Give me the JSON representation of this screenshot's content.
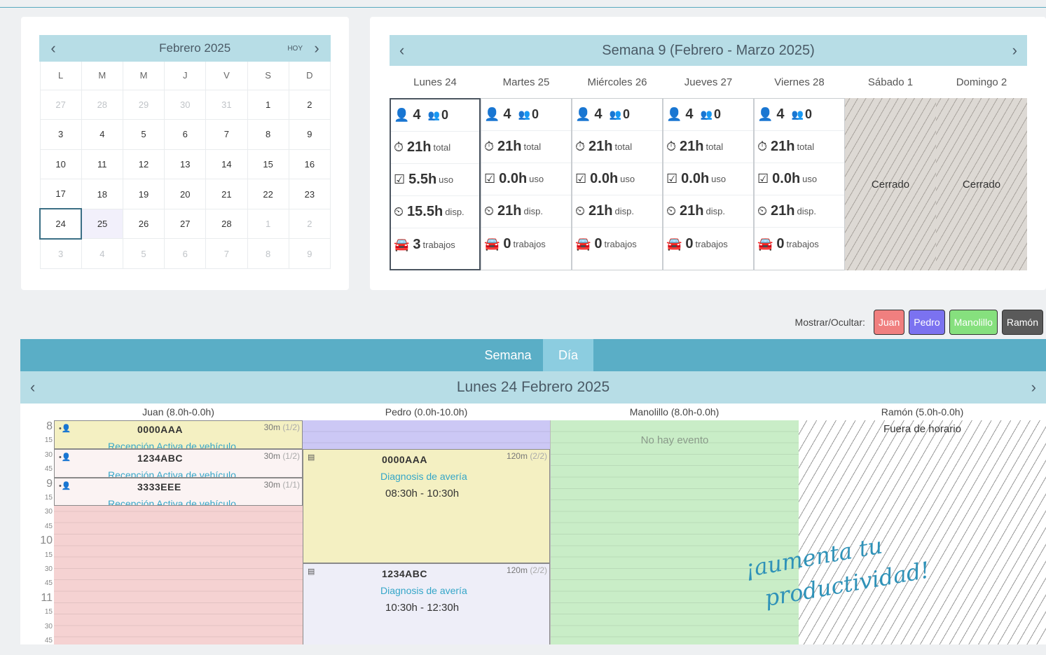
{
  "mini_calendar": {
    "title": "Febrero 2025",
    "today_label": "HOY",
    "prev": "‹",
    "next": "›",
    "weekdays": [
      "L",
      "M",
      "M",
      "J",
      "V",
      "S",
      "D"
    ],
    "weeks": [
      [
        "27",
        "28",
        "29",
        "30",
        "31",
        "1",
        "2"
      ],
      [
        "3",
        "4",
        "5",
        "6",
        "7",
        "8",
        "9"
      ],
      [
        "10",
        "11",
        "12",
        "13",
        "14",
        "15",
        "16"
      ],
      [
        "17",
        "18",
        "19",
        "20",
        "21",
        "22",
        "23"
      ],
      [
        "24",
        "25",
        "26",
        "27",
        "28",
        "1",
        "2"
      ],
      [
        "3",
        "4",
        "5",
        "6",
        "7",
        "8",
        "9"
      ]
    ]
  },
  "week_summary": {
    "title": "Semana 9 (Febrero - Marzo 2025)",
    "prev": "‹",
    "next": "›",
    "days": [
      "Lunes 24",
      "Martes 25",
      "Miércoles 26",
      "Jueves 27",
      "Viernes 28",
      "Sábado 1",
      "Domingo 2"
    ],
    "open_days": [
      {
        "staff": "4",
        "absent": "0",
        "total": "21h",
        "total_label": "total",
        "used": "5.5h",
        "used_label": "uso",
        "avail": "15.5h",
        "avail_label": "disp.",
        "jobs": "3",
        "jobs_label": "trabajos"
      },
      {
        "staff": "4",
        "absent": "0",
        "total": "21h",
        "total_label": "total",
        "used": "0.0h",
        "used_label": "uso",
        "avail": "21h",
        "avail_label": "disp.",
        "jobs": "0",
        "jobs_label": "trabajos"
      },
      {
        "staff": "4",
        "absent": "0",
        "total": "21h",
        "total_label": "total",
        "used": "0.0h",
        "used_label": "uso",
        "avail": "21h",
        "avail_label": "disp.",
        "jobs": "0",
        "jobs_label": "trabajos"
      },
      {
        "staff": "4",
        "absent": "0",
        "total": "21h",
        "total_label": "total",
        "used": "0.0h",
        "used_label": "uso",
        "avail": "21h",
        "avail_label": "disp.",
        "jobs": "0",
        "jobs_label": "trabajos"
      },
      {
        "staff": "4",
        "absent": "0",
        "total": "21h",
        "total_label": "total",
        "used": "0.0h",
        "used_label": "uso",
        "avail": "21h",
        "avail_label": "disp.",
        "jobs": "0",
        "jobs_label": "trabajos"
      }
    ],
    "closed_label": "Cerrado"
  },
  "filter": {
    "label": "Mostrar/Ocultar:",
    "chips": [
      {
        "name": "Juan",
        "color": "#f07f7f"
      },
      {
        "name": "Pedro",
        "color": "#7b72f0"
      },
      {
        "name": "Manolillo",
        "color": "#86e07e"
      },
      {
        "name": "Ramón",
        "color": "#5a5a5a"
      }
    ]
  },
  "tabs": [
    "Semana",
    "Día"
  ],
  "day_view": {
    "title": "Lunes 24 Febrero 2025",
    "prev": "‹",
    "next": "›",
    "columns": [
      "Juan (8.0h-0.0h)",
      "Pedro (0.0h-10.0h)",
      "Manolillo (8.0h-0.0h)",
      "Ramón (5.0h-0.0h)"
    ],
    "time_labels": [
      "8",
      "15",
      "30",
      "45",
      "9",
      "15",
      "30",
      "45",
      "10",
      "15",
      "30",
      "45",
      "11",
      "15",
      "30",
      "45"
    ],
    "juan_events": [
      {
        "plate": "0000AAA",
        "dur": "30m",
        "count": "(1/2)",
        "desc": "Recepción Activa de vehículo"
      },
      {
        "plate": "1234ABC",
        "dur": "30m",
        "count": "(1/2)",
        "desc": "Recepción Activa de vehículo"
      },
      {
        "plate": "3333EEE",
        "dur": "30m",
        "count": "(1/1)",
        "desc": "Recepción Activa de vehículo"
      }
    ],
    "pedro_events": [
      {
        "plate": "0000AAA",
        "dur": "120m",
        "count": "(2/2)",
        "desc": "Diagnosis de avería",
        "range": "08:30h - 10:30h"
      },
      {
        "plate": "1234ABC",
        "dur": "120m",
        "count": "(2/2)",
        "desc": "Diagnosis de avería",
        "range": "10:30h - 12:30h"
      }
    ],
    "manolillo_empty": "No hay evento",
    "ramon_outside": "Fuera de horario",
    "colors": {
      "juan": "#f5d2d2",
      "pedro": "#ccc8f5",
      "manolillo": "#c9edc7",
      "event_yellow": "#f4f0c2",
      "event_pink": "#fbf3f3",
      "event_lavender": "#eeeef8"
    }
  },
  "slogan": [
    "¡aumenta tu",
    "productividad!"
  ]
}
